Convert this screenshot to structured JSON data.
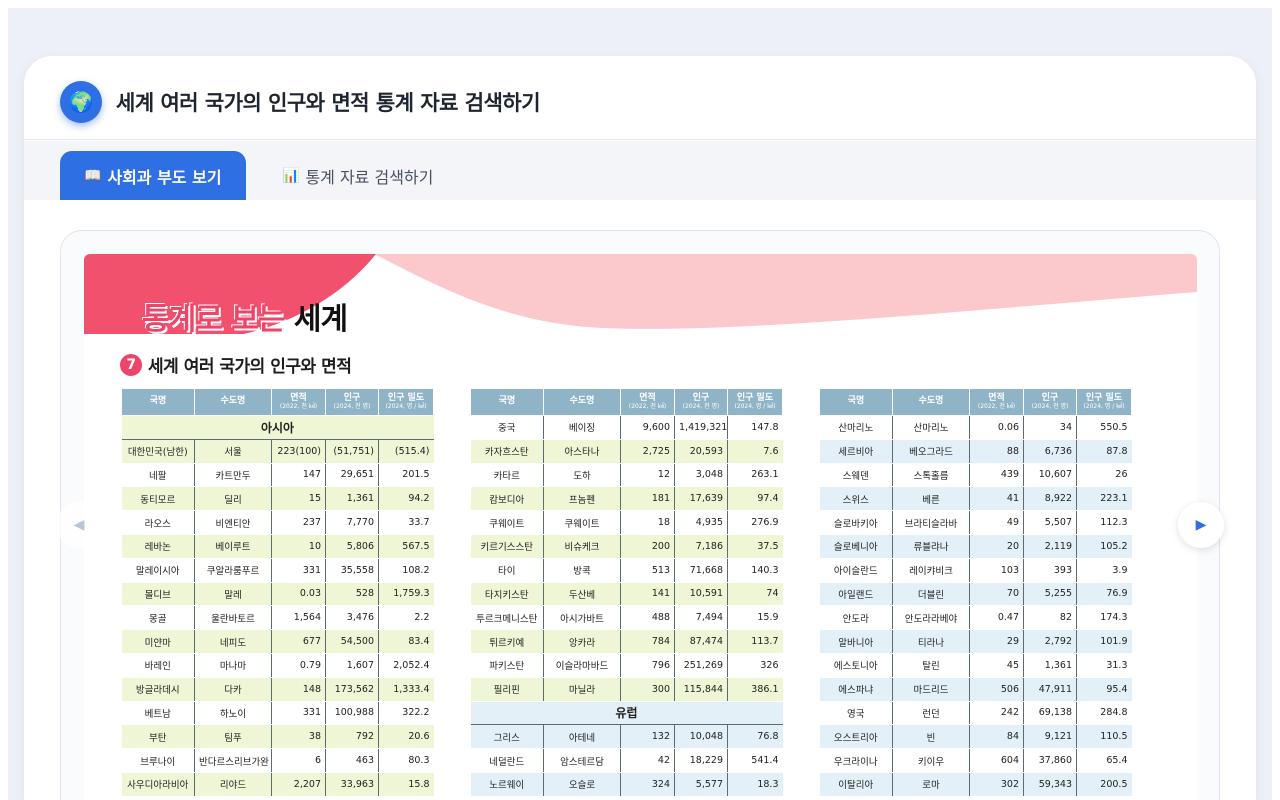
{
  "app": {
    "title": "세계 여러 국가의 인구와 면적 통계 자료 검색하기",
    "icon": "globe-icon"
  },
  "tabs": [
    {
      "label": "사회과 부도 보기",
      "icon": "book-icon",
      "active": true
    },
    {
      "label": "통계 자료 검색하기",
      "icon": "chart-icon",
      "active": false
    }
  ],
  "page": {
    "banner_red": "통계로 보는",
    "banner_black": "세계",
    "section_number": "7",
    "section_title": "세계 여러 국가의 인구와 면적",
    "headers": {
      "country": "국명",
      "capital": "수도명",
      "area": "면적",
      "area_unit": "(2022, 천 ㎢)",
      "pop": "인구",
      "pop_unit": "(2024, 천 명)",
      "density": "인구 밀도",
      "density_unit": "(2024, 명 / ㎢)"
    },
    "table1": {
      "continent": "아시아",
      "rows": [
        [
          "대한민국(남한)",
          "서울",
          "223(100)",
          "(51,751)",
          "(515.4)"
        ],
        [
          "네팔",
          "카트만두",
          "147",
          "29,651",
          "201.5"
        ],
        [
          "동티모르",
          "딜리",
          "15",
          "1,361",
          "94.2"
        ],
        [
          "라오스",
          "비엔티안",
          "237",
          "7,770",
          "33.7"
        ],
        [
          "레바논",
          "베이루트",
          "10",
          "5,806",
          "567.5"
        ],
        [
          "말레이시아",
          "쿠알라룸푸르",
          "331",
          "35,558",
          "108.2"
        ],
        [
          "몰디브",
          "말레",
          "0.03",
          "528",
          "1,759.3"
        ],
        [
          "몽골",
          "울란바토르",
          "1,564",
          "3,476",
          "2.2"
        ],
        [
          "미얀마",
          "네피도",
          "677",
          "54,500",
          "83.4"
        ],
        [
          "바레인",
          "마나마",
          "0.79",
          "1,607",
          "2,052.4"
        ],
        [
          "방글라데시",
          "다카",
          "148",
          "173,562",
          "1,333.4"
        ],
        [
          "베트남",
          "하노이",
          "331",
          "100,988",
          "322.2"
        ],
        [
          "부탄",
          "팀푸",
          "38",
          "792",
          "20.6"
        ],
        [
          "브루나이",
          "반다르스리브가완",
          "6",
          "463",
          "80.3"
        ],
        [
          "사우디아라비아",
          "리야드",
          "2,207",
          "33,963",
          "15.8"
        ]
      ]
    },
    "table2": {
      "rows_a": [
        [
          "중국",
          "베이징",
          "9,600",
          "1,419,321",
          "147.8"
        ],
        [
          "카자흐스탄",
          "아스타나",
          "2,725",
          "20,593",
          "7.6"
        ],
        [
          "카타르",
          "도하",
          "12",
          "3,048",
          "263.1"
        ],
        [
          "캄보디아",
          "프놈펜",
          "181",
          "17,639",
          "97.4"
        ],
        [
          "쿠웨이트",
          "쿠웨이트",
          "18",
          "4,935",
          "276.9"
        ],
        [
          "키르기스스탄",
          "비슈케크",
          "200",
          "7,186",
          "37.5"
        ],
        [
          "타이",
          "방콕",
          "513",
          "71,668",
          "140.3"
        ],
        [
          "타지키스탄",
          "두산베",
          "141",
          "10,591",
          "74"
        ],
        [
          "투르크메니스탄",
          "아시가바트",
          "488",
          "7,494",
          "15.9"
        ],
        [
          "튀르키예",
          "앙카라",
          "784",
          "87,474",
          "113.7"
        ],
        [
          "파키스탄",
          "이슬라마바드",
          "796",
          "251,269",
          "326"
        ],
        [
          "필리핀",
          "마닐라",
          "300",
          "115,844",
          "386.1"
        ]
      ],
      "continent": "유럽",
      "rows_b": [
        [
          "그리스",
          "아테네",
          "132",
          "10,048",
          "76.8"
        ],
        [
          "네덜란드",
          "암스테르담",
          "42",
          "18,229",
          "541.4"
        ],
        [
          "노르웨이",
          "오슬로",
          "324",
          "5,577",
          "18.3"
        ]
      ]
    },
    "table3": {
      "rows": [
        [
          "산마리노",
          "산마리노",
          "0.06",
          "34",
          "550.5"
        ],
        [
          "세르비아",
          "베오그라드",
          "88",
          "6,736",
          "87.8"
        ],
        [
          "스웨덴",
          "스톡홀름",
          "439",
          "10,607",
          "26"
        ],
        [
          "스위스",
          "베른",
          "41",
          "8,922",
          "223.1"
        ],
        [
          "슬로바키아",
          "브라티슬라바",
          "49",
          "5,507",
          "112.3"
        ],
        [
          "슬로베니아",
          "류블랴나",
          "20",
          "2,119",
          "105.2"
        ],
        [
          "아이슬란드",
          "레이캬비크",
          "103",
          "393",
          "3.9"
        ],
        [
          "아일랜드",
          "더블린",
          "70",
          "5,255",
          "76.9"
        ],
        [
          "안도라",
          "안도라라베야",
          "0.47",
          "82",
          "174.3"
        ],
        [
          "알바니아",
          "티라나",
          "29",
          "2,792",
          "101.9"
        ],
        [
          "에스토니아",
          "탈린",
          "45",
          "1,361",
          "31.3"
        ],
        [
          "에스파냐",
          "마드리드",
          "506",
          "47,911",
          "95.4"
        ],
        [
          "영국",
          "런던",
          "242",
          "69,138",
          "284.8"
        ],
        [
          "오스트리아",
          "빈",
          "84",
          "9,121",
          "110.5"
        ],
        [
          "우크라이나",
          "키이우",
          "604",
          "37,860",
          "65.4"
        ],
        [
          "이탈리아",
          "로마",
          "302",
          "59,343",
          "200.5"
        ]
      ]
    }
  },
  "nav": {
    "prev_icon": "chevron-left-icon",
    "next_icon": "chevron-right-icon"
  },
  "colors": {
    "accent": "#2f6fe4",
    "banner_pink": "#f2516e",
    "banner_light": "#fbc8cc",
    "header_teal": "#90b4c7",
    "row_green": "#eef6d6",
    "row_blue": "#e3f0f8"
  }
}
